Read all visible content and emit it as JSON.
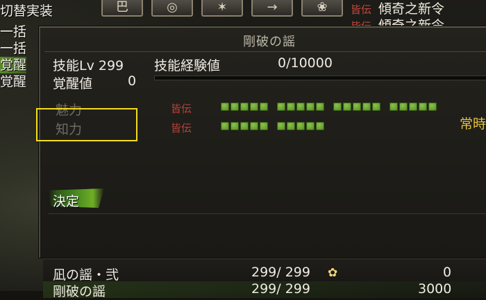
{
  "left_menu": {
    "items": [
      {
        "label": "切替実装"
      },
      {
        "label": "一括"
      },
      {
        "label": "一括"
      },
      {
        "label": "覚醒"
      },
      {
        "label": "覚醒"
      }
    ]
  },
  "toolbar": {
    "buttons": [
      {
        "icon": "scroll-icon",
        "glyph": "巴"
      },
      {
        "icon": "emblem-icon",
        "glyph": "◎"
      },
      {
        "icon": "shield-icon",
        "glyph": "✶"
      },
      {
        "icon": "arrow-right-icon",
        "glyph": "→"
      },
      {
        "icon": "swirl-icon",
        "glyph": "❀"
      }
    ]
  },
  "top_right_list": {
    "rows": [
      {
        "tag": "皆伝",
        "name": "傾奇之新令"
      },
      {
        "tag": "皆伝",
        "name": "傾奇之新令"
      }
    ]
  },
  "dialog": {
    "title": "剛破の謡",
    "skill_level_label": "技能Lv 299",
    "skill_exp_label": "技能経験値",
    "skill_exp_value": "0/10000",
    "awakening_label": "覚醒値",
    "awakening_value": "0",
    "requirements": [
      {
        "label": "魅力",
        "tag": "皆伝",
        "groups": [
          5,
          5,
          5,
          5
        ]
      },
      {
        "label": "知力",
        "tag": "皆伝",
        "groups": [
          5,
          5
        ]
      }
    ],
    "always_label": "常時",
    "decide_label": "決定"
  },
  "skill_list": {
    "rows": [
      {
        "name": "凪の謡・弐",
        "count": "299/ 299",
        "icon": "flower-icon",
        "value": "0"
      },
      {
        "name": "剛破の謡",
        "count": "299/ 299",
        "icon": "",
        "value": "3000"
      }
    ]
  },
  "colors": {
    "accent_green": "#5f9a2a",
    "tag_red": "#b8433a",
    "highlight_yellow": "#f5de1c",
    "always_gold": "#e5c43a"
  }
}
